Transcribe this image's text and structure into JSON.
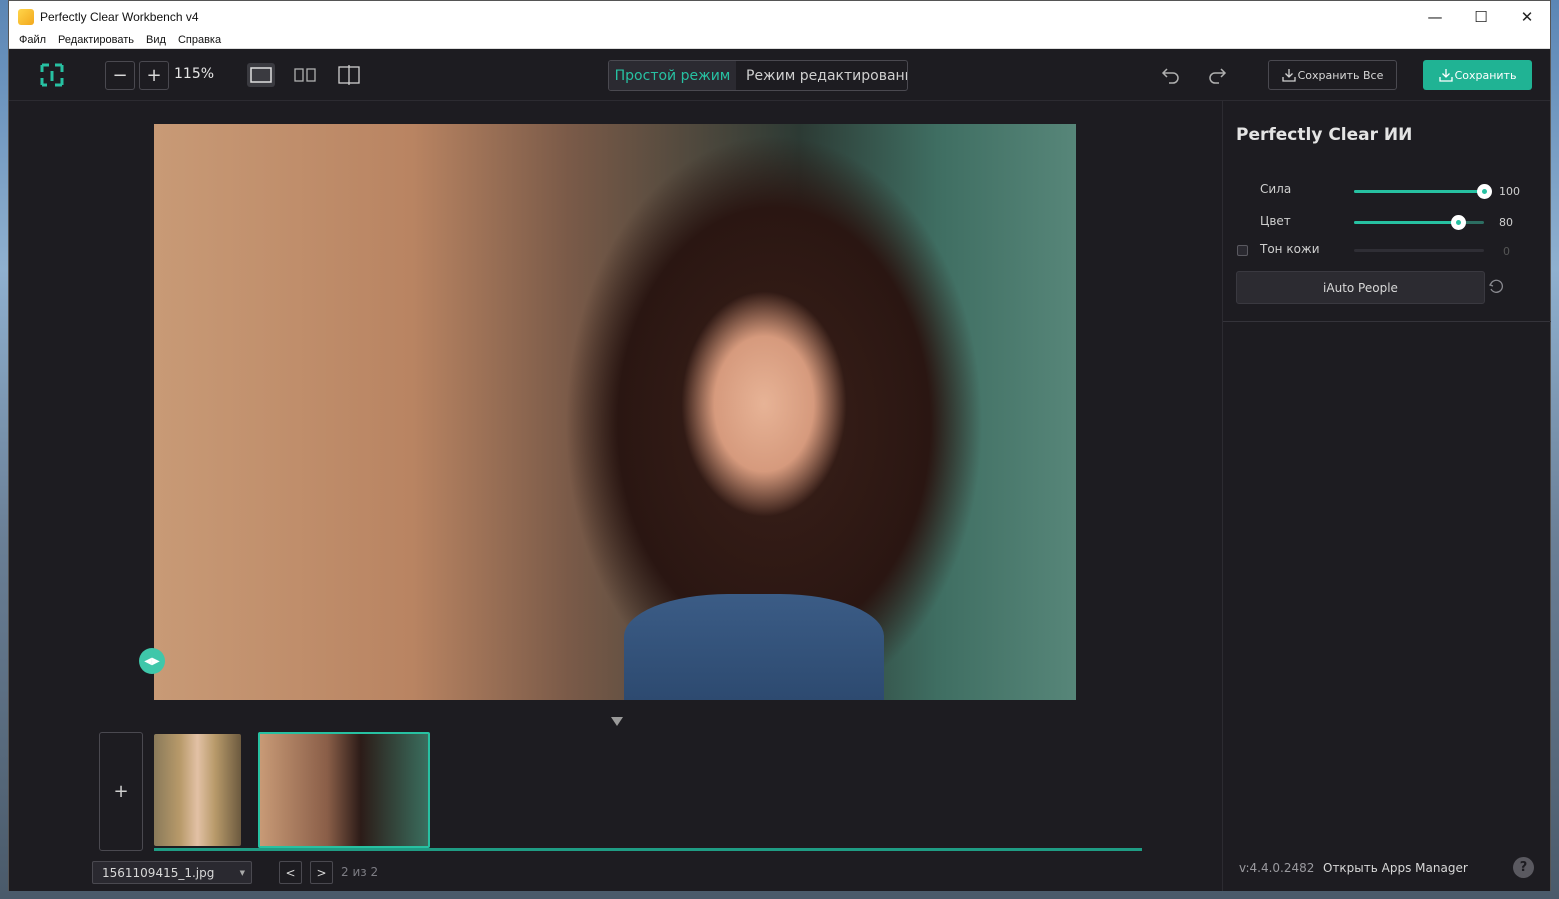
{
  "window": {
    "title": "Perfectly Clear Workbench v4"
  },
  "menu": [
    "Файл",
    "Редактировать",
    "Вид",
    "Справка"
  ],
  "toolbar": {
    "zoom_out": "−",
    "zoom_in": "+",
    "zoom_level": "115%",
    "mode_simple": "Простой режим",
    "mode_edit": "Режим редактирования",
    "save_all": "Сохранить Все",
    "save": "Сохранить"
  },
  "panel": {
    "title": "Perfectly Clear ИИ",
    "sliders": [
      {
        "label": "Сила",
        "value": "100",
        "fraction": 1.0,
        "enabled": true
      },
      {
        "label": "Цвет",
        "value": "80",
        "fraction": 0.8,
        "enabled": true
      },
      {
        "label": "Тон кожи",
        "value": "0",
        "fraction": 0.0,
        "enabled": false
      }
    ],
    "iauto_label": "iAuto People",
    "version": "v:4.4.0.2482",
    "apps_manager": "Открыть Apps Manager",
    "help": "?"
  },
  "filmstrip": {
    "add": "+",
    "file_name": "1561109415_1.jpg",
    "prev": "<",
    "next": ">",
    "page_count": "2 из 2"
  },
  "colors": {
    "accent": "#27c1a2",
    "save_bg": "#20b394",
    "bg": "#1d1c21"
  }
}
